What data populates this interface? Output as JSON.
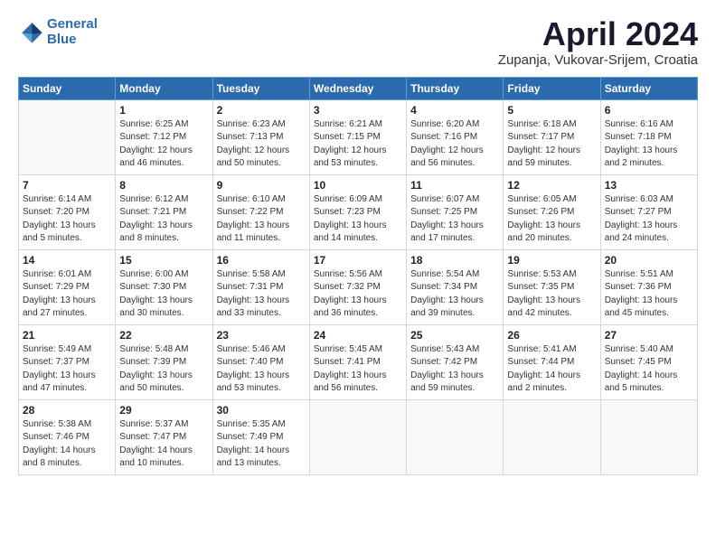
{
  "header": {
    "logo_line1": "General",
    "logo_line2": "Blue",
    "month_title": "April 2024",
    "subtitle": "Zupanja, Vukovar-Srijem, Croatia"
  },
  "weekdays": [
    "Sunday",
    "Monday",
    "Tuesday",
    "Wednesday",
    "Thursday",
    "Friday",
    "Saturday"
  ],
  "weeks": [
    [
      {
        "day": "",
        "sunrise": "",
        "sunset": "",
        "daylight": ""
      },
      {
        "day": "1",
        "sunrise": "Sunrise: 6:25 AM",
        "sunset": "Sunset: 7:12 PM",
        "daylight": "Daylight: 12 hours and 46 minutes."
      },
      {
        "day": "2",
        "sunrise": "Sunrise: 6:23 AM",
        "sunset": "Sunset: 7:13 PM",
        "daylight": "Daylight: 12 hours and 50 minutes."
      },
      {
        "day": "3",
        "sunrise": "Sunrise: 6:21 AM",
        "sunset": "Sunset: 7:15 PM",
        "daylight": "Daylight: 12 hours and 53 minutes."
      },
      {
        "day": "4",
        "sunrise": "Sunrise: 6:20 AM",
        "sunset": "Sunset: 7:16 PM",
        "daylight": "Daylight: 12 hours and 56 minutes."
      },
      {
        "day": "5",
        "sunrise": "Sunrise: 6:18 AM",
        "sunset": "Sunset: 7:17 PM",
        "daylight": "Daylight: 12 hours and 59 minutes."
      },
      {
        "day": "6",
        "sunrise": "Sunrise: 6:16 AM",
        "sunset": "Sunset: 7:18 PM",
        "daylight": "Daylight: 13 hours and 2 minutes."
      }
    ],
    [
      {
        "day": "7",
        "sunrise": "Sunrise: 6:14 AM",
        "sunset": "Sunset: 7:20 PM",
        "daylight": "Daylight: 13 hours and 5 minutes."
      },
      {
        "day": "8",
        "sunrise": "Sunrise: 6:12 AM",
        "sunset": "Sunset: 7:21 PM",
        "daylight": "Daylight: 13 hours and 8 minutes."
      },
      {
        "day": "9",
        "sunrise": "Sunrise: 6:10 AM",
        "sunset": "Sunset: 7:22 PM",
        "daylight": "Daylight: 13 hours and 11 minutes."
      },
      {
        "day": "10",
        "sunrise": "Sunrise: 6:09 AM",
        "sunset": "Sunset: 7:23 PM",
        "daylight": "Daylight: 13 hours and 14 minutes."
      },
      {
        "day": "11",
        "sunrise": "Sunrise: 6:07 AM",
        "sunset": "Sunset: 7:25 PM",
        "daylight": "Daylight: 13 hours and 17 minutes."
      },
      {
        "day": "12",
        "sunrise": "Sunrise: 6:05 AM",
        "sunset": "Sunset: 7:26 PM",
        "daylight": "Daylight: 13 hours and 20 minutes."
      },
      {
        "day": "13",
        "sunrise": "Sunrise: 6:03 AM",
        "sunset": "Sunset: 7:27 PM",
        "daylight": "Daylight: 13 hours and 24 minutes."
      }
    ],
    [
      {
        "day": "14",
        "sunrise": "Sunrise: 6:01 AM",
        "sunset": "Sunset: 7:29 PM",
        "daylight": "Daylight: 13 hours and 27 minutes."
      },
      {
        "day": "15",
        "sunrise": "Sunrise: 6:00 AM",
        "sunset": "Sunset: 7:30 PM",
        "daylight": "Daylight: 13 hours and 30 minutes."
      },
      {
        "day": "16",
        "sunrise": "Sunrise: 5:58 AM",
        "sunset": "Sunset: 7:31 PM",
        "daylight": "Daylight: 13 hours and 33 minutes."
      },
      {
        "day": "17",
        "sunrise": "Sunrise: 5:56 AM",
        "sunset": "Sunset: 7:32 PM",
        "daylight": "Daylight: 13 hours and 36 minutes."
      },
      {
        "day": "18",
        "sunrise": "Sunrise: 5:54 AM",
        "sunset": "Sunset: 7:34 PM",
        "daylight": "Daylight: 13 hours and 39 minutes."
      },
      {
        "day": "19",
        "sunrise": "Sunrise: 5:53 AM",
        "sunset": "Sunset: 7:35 PM",
        "daylight": "Daylight: 13 hours and 42 minutes."
      },
      {
        "day": "20",
        "sunrise": "Sunrise: 5:51 AM",
        "sunset": "Sunset: 7:36 PM",
        "daylight": "Daylight: 13 hours and 45 minutes."
      }
    ],
    [
      {
        "day": "21",
        "sunrise": "Sunrise: 5:49 AM",
        "sunset": "Sunset: 7:37 PM",
        "daylight": "Daylight: 13 hours and 47 minutes."
      },
      {
        "day": "22",
        "sunrise": "Sunrise: 5:48 AM",
        "sunset": "Sunset: 7:39 PM",
        "daylight": "Daylight: 13 hours and 50 minutes."
      },
      {
        "day": "23",
        "sunrise": "Sunrise: 5:46 AM",
        "sunset": "Sunset: 7:40 PM",
        "daylight": "Daylight: 13 hours and 53 minutes."
      },
      {
        "day": "24",
        "sunrise": "Sunrise: 5:45 AM",
        "sunset": "Sunset: 7:41 PM",
        "daylight": "Daylight: 13 hours and 56 minutes."
      },
      {
        "day": "25",
        "sunrise": "Sunrise: 5:43 AM",
        "sunset": "Sunset: 7:42 PM",
        "daylight": "Daylight: 13 hours and 59 minutes."
      },
      {
        "day": "26",
        "sunrise": "Sunrise: 5:41 AM",
        "sunset": "Sunset: 7:44 PM",
        "daylight": "Daylight: 14 hours and 2 minutes."
      },
      {
        "day": "27",
        "sunrise": "Sunrise: 5:40 AM",
        "sunset": "Sunset: 7:45 PM",
        "daylight": "Daylight: 14 hours and 5 minutes."
      }
    ],
    [
      {
        "day": "28",
        "sunrise": "Sunrise: 5:38 AM",
        "sunset": "Sunset: 7:46 PM",
        "daylight": "Daylight: 14 hours and 8 minutes."
      },
      {
        "day": "29",
        "sunrise": "Sunrise: 5:37 AM",
        "sunset": "Sunset: 7:47 PM",
        "daylight": "Daylight: 14 hours and 10 minutes."
      },
      {
        "day": "30",
        "sunrise": "Sunrise: 5:35 AM",
        "sunset": "Sunset: 7:49 PM",
        "daylight": "Daylight: 14 hours and 13 minutes."
      },
      {
        "day": "",
        "sunrise": "",
        "sunset": "",
        "daylight": ""
      },
      {
        "day": "",
        "sunrise": "",
        "sunset": "",
        "daylight": ""
      },
      {
        "day": "",
        "sunrise": "",
        "sunset": "",
        "daylight": ""
      },
      {
        "day": "",
        "sunrise": "",
        "sunset": "",
        "daylight": ""
      }
    ]
  ]
}
